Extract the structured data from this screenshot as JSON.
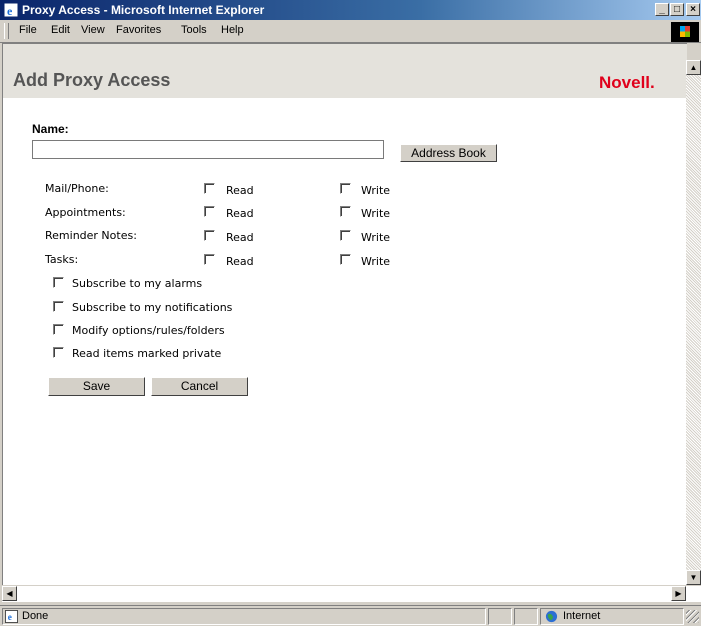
{
  "window": {
    "title": "Proxy Access - Microsoft Internet Explorer"
  },
  "menu": [
    {
      "label": "File"
    },
    {
      "label": "Edit"
    },
    {
      "label": "View"
    },
    {
      "label": "Favorites"
    },
    {
      "label": "Tools"
    },
    {
      "label": "Help"
    }
  ],
  "page": {
    "title": "Add Proxy Access",
    "logo": "Novell."
  },
  "form": {
    "name_label": "Name:",
    "name_value": "",
    "address_book_label": "Address Book",
    "permissions": [
      {
        "label": "Mail/Phone:",
        "read_label": "Read",
        "write_label": "Write",
        "read": false,
        "write": false
      },
      {
        "label": "Appointments:",
        "read_label": "Read",
        "write_label": "Write",
        "read": false,
        "write": false
      },
      {
        "label": "Reminder Notes:",
        "read_label": "Read",
        "write_label": "Write",
        "read": false,
        "write": false
      },
      {
        "label": "Tasks:",
        "read_label": "Read",
        "write_label": "Write",
        "read": false,
        "write": false
      }
    ],
    "options": [
      {
        "label": "Subscribe to my alarms",
        "checked": false
      },
      {
        "label": "Subscribe to my notifications",
        "checked": false
      },
      {
        "label": "Modify options/rules/folders",
        "checked": false
      },
      {
        "label": "Read items marked private",
        "checked": false
      }
    ],
    "save_label": "Save",
    "cancel_label": "Cancel"
  },
  "status": {
    "text": "Done",
    "zone": "Internet"
  },
  "colors": {
    "title_bar": "#0a246a",
    "header_bg": "#e4e2dc",
    "logo": "#e0001b",
    "title_text": "#555555"
  },
  "icons": [
    "ie-page-icon",
    "windows-flag-icon",
    "globe-icon"
  ]
}
